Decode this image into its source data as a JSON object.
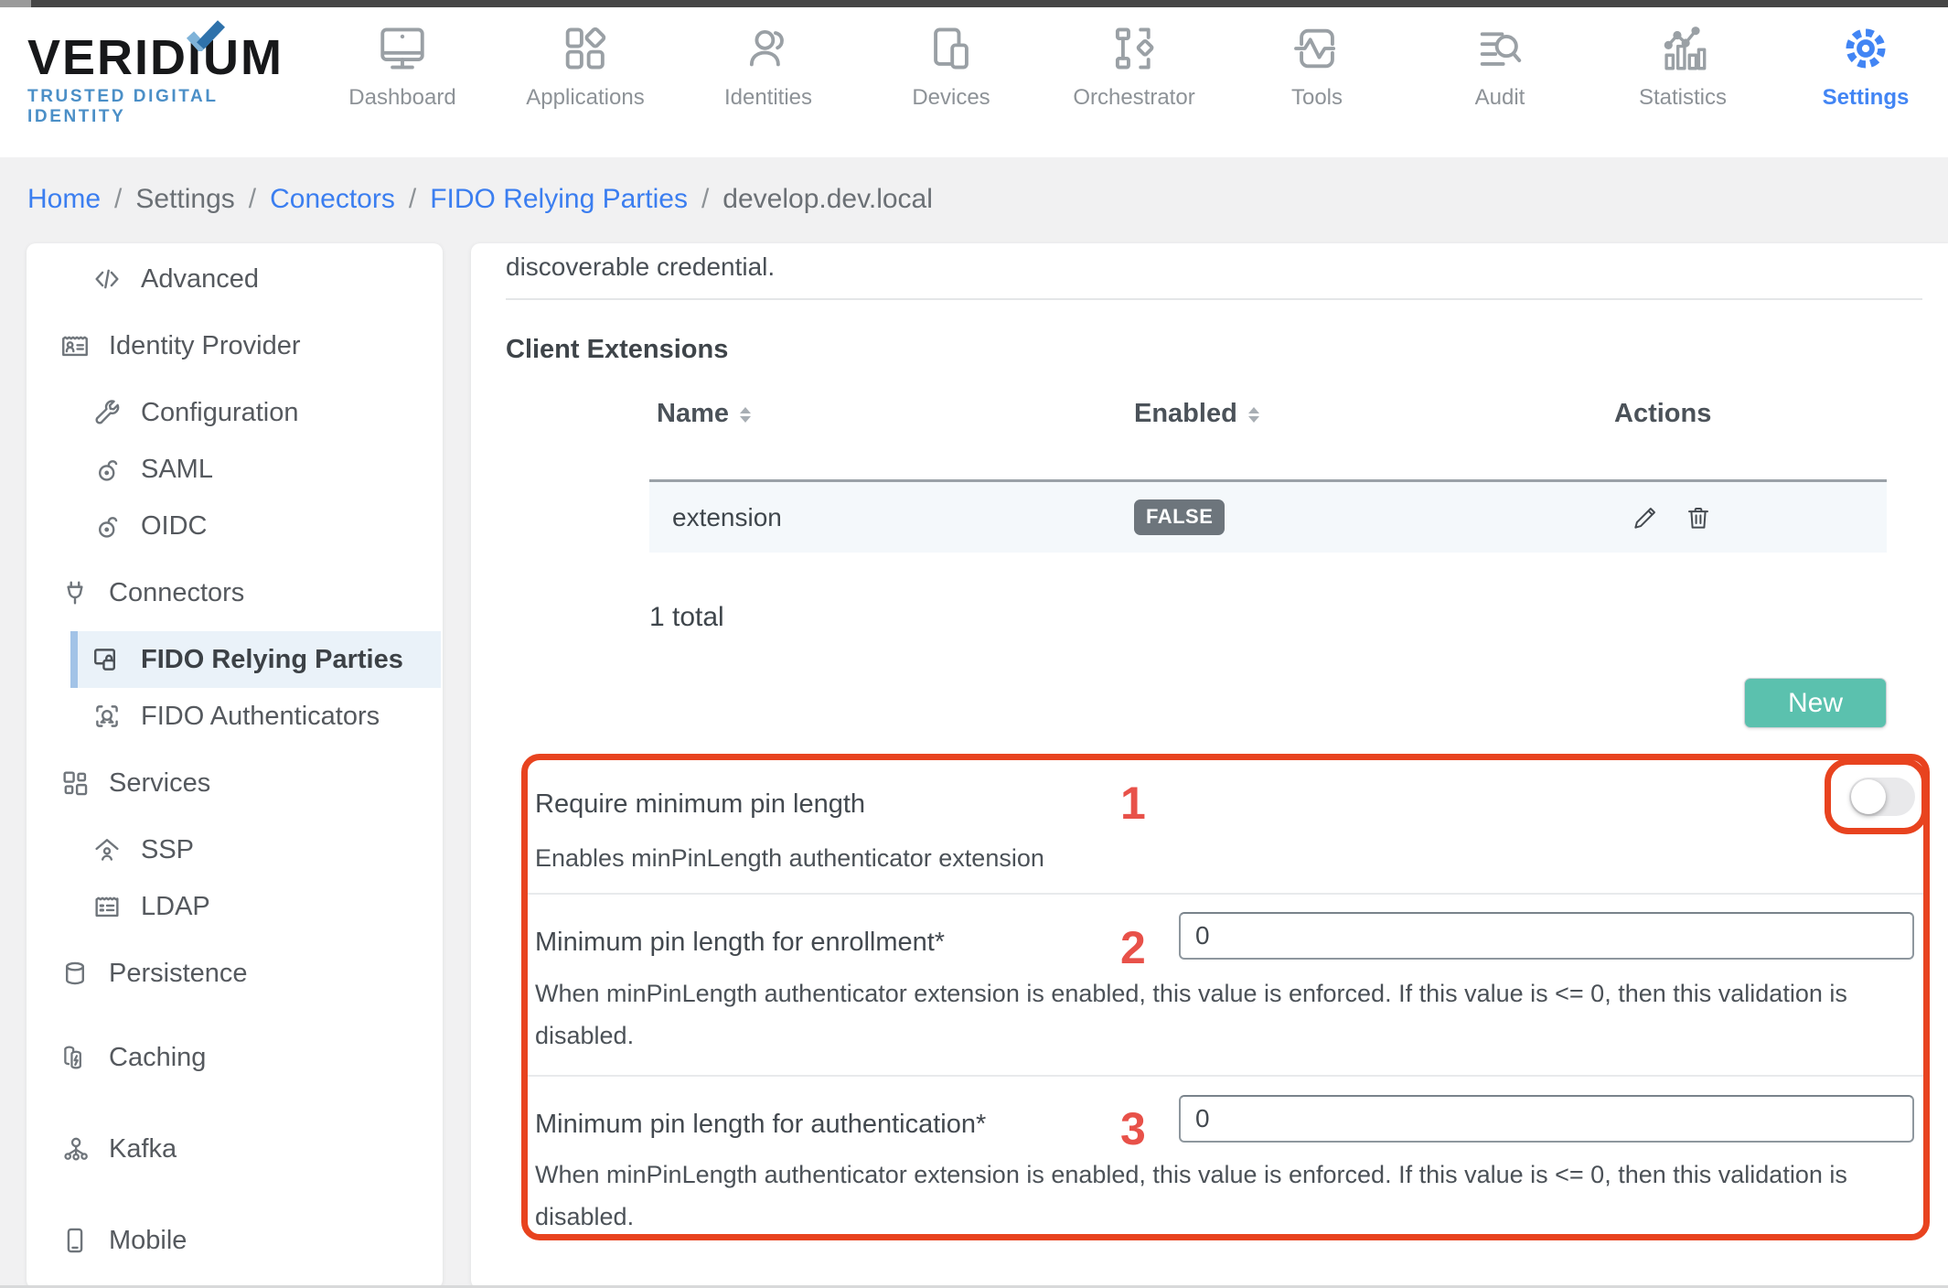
{
  "brand": {
    "name": "VERIDIUM",
    "tagline": "TRUSTED DIGITAL IDENTITY"
  },
  "nav": {
    "items": [
      {
        "label": "Dashboard",
        "icon": "monitor",
        "active": false
      },
      {
        "label": "Applications",
        "icon": "app-grid",
        "active": false
      },
      {
        "label": "Identities",
        "icon": "users",
        "active": false
      },
      {
        "label": "Devices",
        "icon": "devices",
        "active": false
      },
      {
        "label": "Orchestrator",
        "icon": "flowchart",
        "active": false
      },
      {
        "label": "Tools",
        "icon": "activity",
        "active": false
      },
      {
        "label": "Audit",
        "icon": "list-search",
        "active": false
      },
      {
        "label": "Statistics",
        "icon": "bar-chart",
        "active": false
      },
      {
        "label": "Settings",
        "icon": "gear",
        "active": true
      }
    ]
  },
  "breadcrumb": {
    "separator": "/",
    "items": [
      {
        "label": "Home",
        "type": "link"
      },
      {
        "label": "Settings",
        "type": "text"
      },
      {
        "label": "Conectors",
        "type": "link"
      },
      {
        "label": "FIDO Relying Parties",
        "type": "link"
      },
      {
        "label": "develop.dev.local",
        "type": "current"
      }
    ]
  },
  "sidebar": {
    "items": [
      {
        "label": "Advanced",
        "level": "sub",
        "icon": "code",
        "selected": false
      },
      {
        "label": "Identity Provider",
        "level": "top",
        "icon": "id-card",
        "selected": false
      },
      {
        "label": "Configuration",
        "level": "sub",
        "icon": "wrench",
        "selected": false
      },
      {
        "label": "SAML",
        "level": "sub",
        "icon": "key-ring",
        "selected": false
      },
      {
        "label": "OIDC",
        "level": "sub",
        "icon": "key-ring",
        "selected": false
      },
      {
        "label": "Connectors",
        "level": "top",
        "icon": "plug",
        "selected": false
      },
      {
        "label": "FIDO Relying Parties",
        "level": "sub",
        "icon": "screen-lock",
        "selected": true
      },
      {
        "label": "FIDO Authenticators",
        "level": "sub",
        "icon": "face-scan",
        "selected": false
      },
      {
        "label": "Services",
        "level": "top",
        "icon": "grid",
        "selected": false
      },
      {
        "label": "SSP",
        "level": "sub",
        "icon": "home-user",
        "selected": false
      },
      {
        "label": "LDAP",
        "level": "sub",
        "icon": "address-card",
        "selected": false
      },
      {
        "label": "Persistence",
        "level": "top",
        "icon": "database",
        "selected": false
      },
      {
        "label": "Caching",
        "level": "top",
        "icon": "cache",
        "selected": false
      },
      {
        "label": "Kafka",
        "level": "top",
        "icon": "nodes",
        "selected": false
      },
      {
        "label": "Mobile",
        "level": "top",
        "icon": "phone",
        "selected": false
      }
    ]
  },
  "main": {
    "intro_text": "discoverable credential.",
    "section_title": "Client Extensions",
    "table": {
      "columns": [
        {
          "label": "Name",
          "sortable": true
        },
        {
          "label": "Enabled",
          "sortable": true
        },
        {
          "label": "Actions",
          "sortable": false
        }
      ],
      "rows": [
        {
          "name": "extension",
          "enabled": "FALSE"
        }
      ],
      "total_label": "1 total"
    },
    "new_button_label": "New",
    "settings": [
      {
        "number": "1",
        "label": "Require minimum pin length",
        "description": "Enables minPinLength authenticator extension",
        "control": "toggle",
        "state": "off"
      },
      {
        "number": "2",
        "label": "Minimum pin length for enrollment*",
        "value": "0",
        "description": "When minPinLength authenticator extension is enabled, this value is enforced. If this value is <= 0, then this validation is disabled."
      },
      {
        "number": "3",
        "label": "Minimum pin length for authentication*",
        "value": "0",
        "description": "When minPinLength authenticator extension is enabled, this value is enforced. If this value is <= 0, then this validation is disabled."
      }
    ]
  },
  "colors": {
    "accent_blue": "#4285f4",
    "link_blue": "#3b7ef0",
    "teal_button": "#5bc1ae",
    "annotation_red": "#e8431f",
    "badge_gray": "#6d757c",
    "selected_bg": "#eaf2f9",
    "selected_bar": "#a2c3e7",
    "row_bg": "#f4f8fb"
  }
}
